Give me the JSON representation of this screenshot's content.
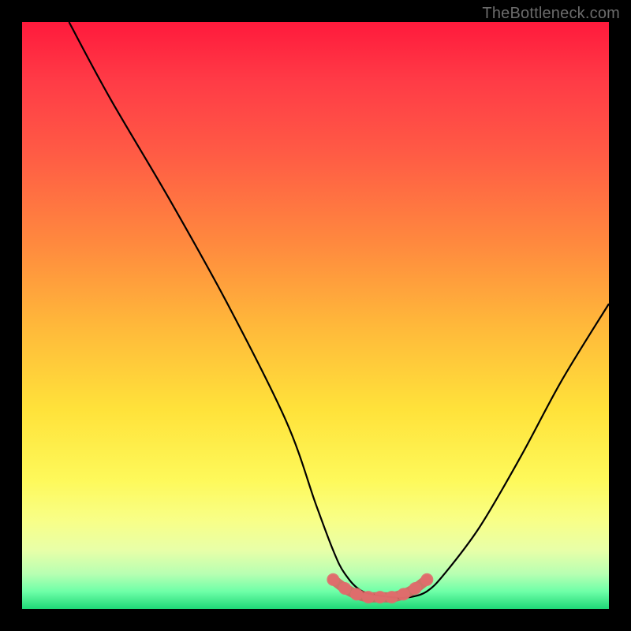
{
  "watermark": "TheBottleneck.com",
  "chart_data": {
    "type": "line",
    "title": "",
    "xlabel": "",
    "ylabel": "",
    "xlim": [
      0,
      100
    ],
    "ylim": [
      0,
      100
    ],
    "grid": false,
    "legend": false,
    "series": [
      {
        "name": "curve",
        "x": [
          8,
          15,
          25,
          35,
          45,
          50,
          53,
          55,
          58,
          63,
          66,
          69,
          72,
          78,
          85,
          92,
          100
        ],
        "y": [
          100,
          87,
          70,
          52,
          32,
          18,
          10,
          6,
          3,
          2,
          2,
          3,
          6,
          14,
          26,
          39,
          52
        ]
      },
      {
        "name": "highlight-dots",
        "x": [
          53,
          55,
          57,
          59,
          61,
          63,
          65,
          67,
          69
        ],
        "y": [
          5,
          3.5,
          2.5,
          2,
          2,
          2,
          2.5,
          3.5,
          5
        ]
      }
    ],
    "gradient_stops": [
      {
        "pos": 0,
        "color": "#ff1a3c"
      },
      {
        "pos": 22,
        "color": "#ff5a45"
      },
      {
        "pos": 52,
        "color": "#ffb93a"
      },
      {
        "pos": 78,
        "color": "#fef95a"
      },
      {
        "pos": 94,
        "color": "#b8ffb2"
      },
      {
        "pos": 100,
        "color": "#1fd877"
      }
    ],
    "colors": {
      "curve_stroke": "#000000",
      "highlight_fill": "#e06d6d",
      "highlight_stroke": "#d85a5a",
      "frame": "#000000",
      "watermark": "#6b6b6b"
    }
  }
}
